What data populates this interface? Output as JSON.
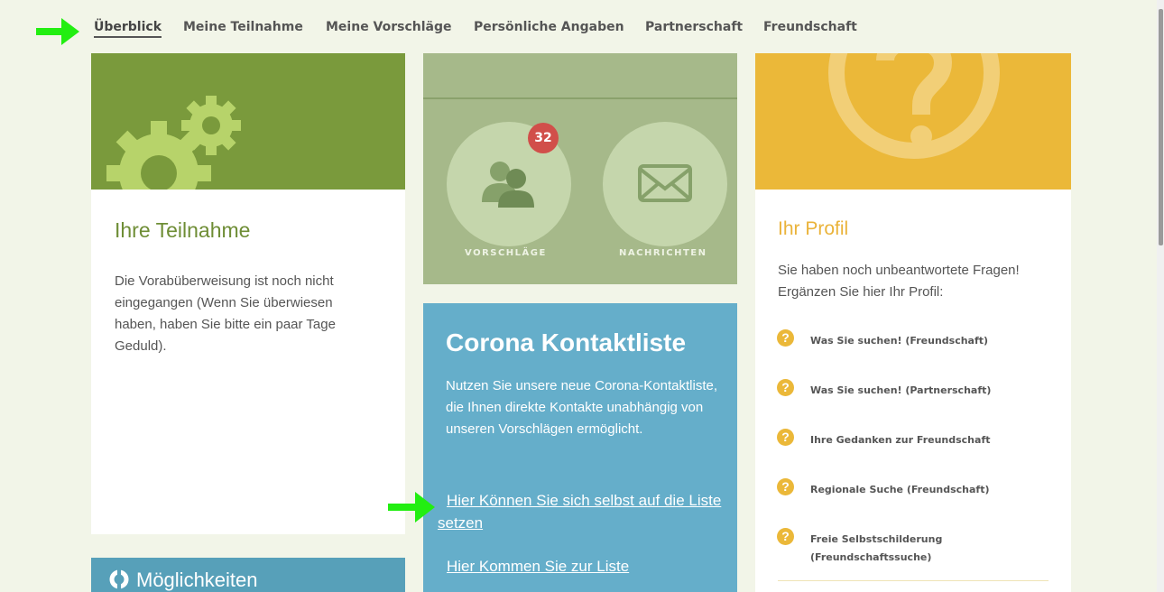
{
  "nav": {
    "items": [
      {
        "label": "Überblick",
        "active": true
      },
      {
        "label": "Meine Teilnahme"
      },
      {
        "label": "Meine Vorschläge"
      },
      {
        "label": "Persönliche Angaben"
      },
      {
        "label": "Partnerschaft"
      },
      {
        "label": "Freundschaft"
      }
    ]
  },
  "participation": {
    "title": "Ihre Teilnahme",
    "text": "Die Vorabüberweisung ist noch nicht eingegangen (Wenn Sie überwiesen haben, haben Sie bitte ein paar Tage Geduld)."
  },
  "possibilities": {
    "title": "Möglichkeiten"
  },
  "stats": {
    "suggestions_label": "VORSCHLÄGE",
    "suggestions_count": "32",
    "messages_label": "NACHRICHTEN"
  },
  "corona": {
    "title": "Corona Kontaktliste",
    "text": "Nutzen Sie unsere neue Corona-Kontaktliste, die Ihnen direkte Kontakte unabhängig von unseren Vorschlägen ermöglicht.",
    "link_add": "Hier Können Sie sich selbst auf die Liste setzen",
    "link_view": "Hier Kommen Sie zur Liste"
  },
  "profile": {
    "title": "Ihr Profil",
    "text": "Sie haben noch unbeantwortete Fragen! Ergänzen Sie hier Ihr Profil:",
    "questions": [
      "Was Sie suchen! (Freundschaft)",
      "Was Sie suchen! (Partnerschaft)",
      "Ihre Gedanken zur Freundschaft",
      "Regionale Suche (Freundschaft)",
      "Freie Selbstschilderung (Freundschaftssuche)"
    ]
  },
  "colors": {
    "green": "#7a9a3c",
    "sage": "#a6b98a",
    "blue": "#65aeca",
    "yellow": "#ebb839",
    "badge": "#d14f4a",
    "arrow": "#22ee11"
  }
}
